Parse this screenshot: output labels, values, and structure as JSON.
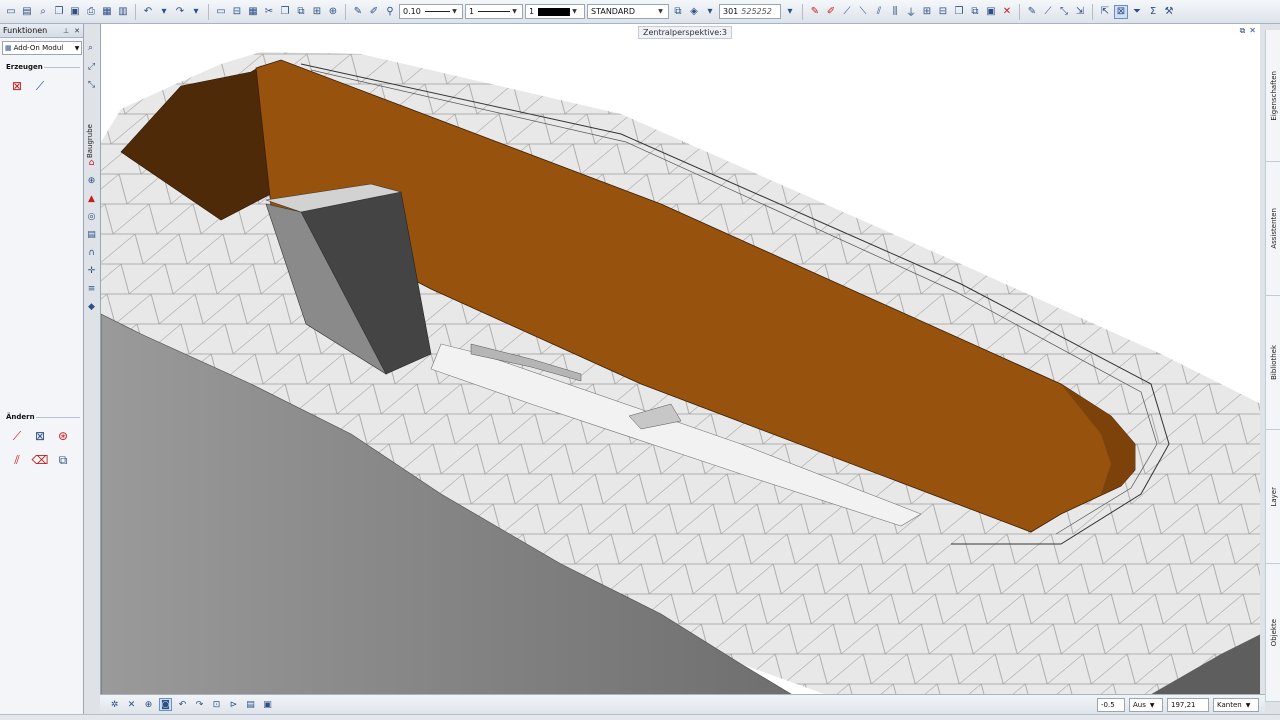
{
  "toolbar": {
    "pen_thickness": "0.10",
    "line_type": "1",
    "color_number": "1",
    "layer": "STANDARD",
    "hatch_number": "301",
    "hatch_pattern": "525252",
    "colors": {
      "icon": "#2c4f86",
      "delete": "#c41d1d"
    }
  },
  "viewport": {
    "title": "Zentralperspektive:3",
    "colors": {
      "wall_front": "#97520e",
      "wall_dark": "#4e2a08",
      "terrain": "#e8e8e8",
      "block": "#444444"
    }
  },
  "panel": {
    "title": "Funktionen",
    "module": "Add-On Modul",
    "vertical_tab": "Baugrube",
    "sections": {
      "create": "Erzeugen",
      "modify": "Ändern"
    }
  },
  "right_dock": {
    "tabs": [
      "Eigenschaften",
      "Assistenten",
      "Bibliothek",
      "Layer",
      "Objekte"
    ]
  },
  "status": {
    "value1": "-0.5",
    "value2": "Aus",
    "value3": "197,21",
    "value4": "Kanten"
  }
}
